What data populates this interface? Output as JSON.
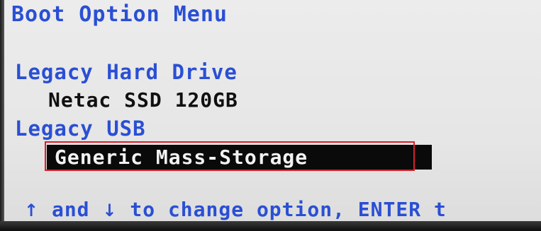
{
  "menu": {
    "title": "Boot Option Menu"
  },
  "boot_groups": [
    {
      "category": "Legacy Hard Drive",
      "devices": [
        "Netac SSD 120GB"
      ]
    },
    {
      "category": "Legacy USB",
      "devices": [
        "Generic Mass-Storage"
      ],
      "selected": true
    }
  ],
  "annotation": {
    "color": "#d8202a"
  },
  "footer": {
    "up_arrow": "↑",
    "and_text": " and ",
    "down_arrow": "↓",
    "rest_text": " to change option, ENTER t"
  },
  "colors": {
    "category_text": "#2a4fd4",
    "device_text": "#101010",
    "selection_bg": "#0a0a0a",
    "selection_text": "#f2f2f2",
    "background": "#ececec"
  }
}
